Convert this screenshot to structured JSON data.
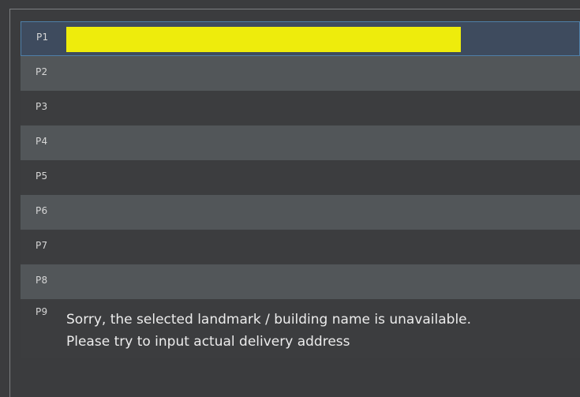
{
  "rows": [
    {
      "label": "P1"
    },
    {
      "label": "P2"
    },
    {
      "label": "P3"
    },
    {
      "label": "P4"
    },
    {
      "label": "P5"
    },
    {
      "label": "P6"
    },
    {
      "label": "P7"
    },
    {
      "label": "P8"
    },
    {
      "label": "P9"
    }
  ],
  "message": "Sorry, the selected landmark / building name is unavailable. Please try to input actual delivery address",
  "colors": {
    "background": "#3b3c3e",
    "row_alt": "#525659",
    "selected_row": "#3e4b5e",
    "selected_border": "#4f7fa8",
    "highlight": "#eeec0c",
    "text": "#ececec"
  }
}
